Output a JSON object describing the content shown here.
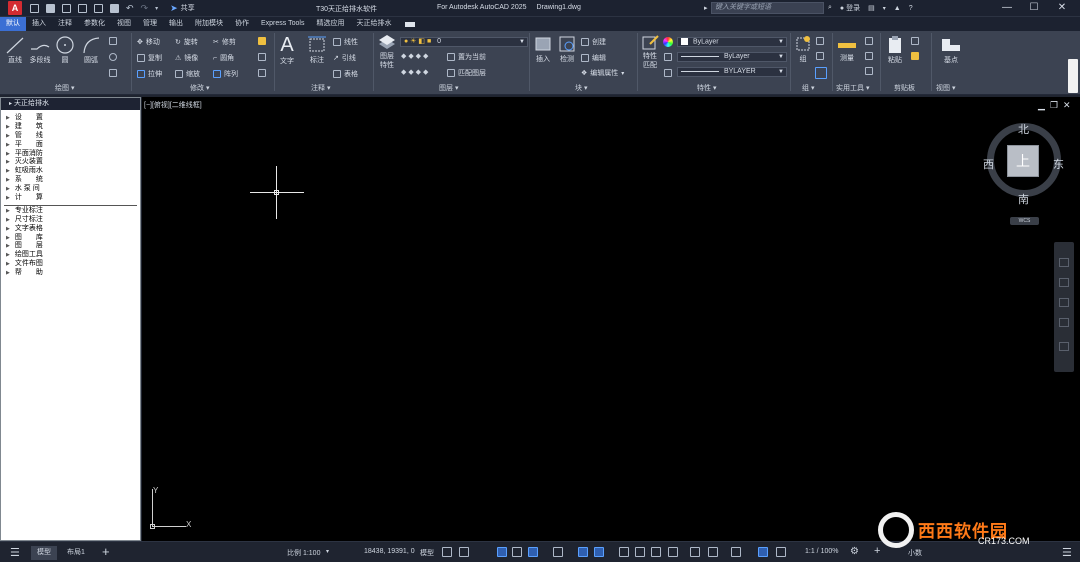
{
  "titlebar": {
    "app_title": "T30天正给排水软件",
    "product": "For Autodesk AutoCAD 2025",
    "document": "Drawing1.dwg",
    "share_label": "共享",
    "search_placeholder": "键入关键字或短语",
    "login_label": "登录",
    "app_logo": "A"
  },
  "tabs": [
    "默认",
    "插入",
    "注释",
    "参数化",
    "视图",
    "管理",
    "输出",
    "附加模块",
    "协作",
    "Express Tools",
    "精选应用",
    "天正给排水"
  ],
  "ribbon": {
    "draw": {
      "line": "直线",
      "polyline": "多段线",
      "circle": "圆",
      "arc": "圆弧",
      "title": "绘图 ▾"
    },
    "modify": {
      "move": "移动",
      "rotate": "旋转",
      "trim": "修剪",
      "copy": "复制",
      "mirror": "镜像",
      "fillet": "圆角",
      "stretch": "拉伸",
      "scale": "缩放",
      "array": "阵列",
      "title": "修改 ▾"
    },
    "annotation": {
      "text": "文字",
      "dimension": "标注",
      "linear": "线性",
      "leader": "引线",
      "table": "表格",
      "title": "注释 ▾"
    },
    "layers": {
      "layer_props": "图层\n特性",
      "current_layer": "0",
      "set_current": "置为当前",
      "match_layer": "匹配图层",
      "title": "图层 ▾"
    },
    "block": {
      "insert": "插入",
      "edit": "检测",
      "create": "创建",
      "edit_block": "编辑",
      "edit_attr": "编辑属性",
      "title": "块 ▾"
    },
    "properties": {
      "match": "特性\n匹配",
      "color": "ByLayer",
      "linetype": "ByLayer",
      "lineweight": "BYLAYER",
      "title": "特性 ▾"
    },
    "groups": {
      "group": "组",
      "title": "组 ▾"
    },
    "utilities": {
      "measure": "测量",
      "title": "实用工具 ▾"
    },
    "clipboard": {
      "paste": "粘贴",
      "title": "剪贴板"
    },
    "view": {
      "base": "基点",
      "title": "视图 ▾"
    }
  },
  "palette": {
    "title": "天正给排水",
    "group1": [
      "设　　置",
      "建　　筑",
      "管　　线",
      "平　　面",
      "平面消防",
      "灭火装置",
      "虹吸雨水",
      "系　　统",
      "水 泵 间",
      "计　　算"
    ],
    "group2": [
      "专业标注",
      "尺寸标注",
      "文字表格",
      "图　　库",
      "图　　层",
      "绘图工具",
      "文件布图",
      "帮　　助"
    ]
  },
  "canvas": {
    "view_label": "[−][俯视][二维线框]",
    "ucs_x": "X",
    "ucs_y": "Y",
    "viewcube": {
      "north": "北",
      "south": "南",
      "east": "东",
      "west": "西",
      "top": "上",
      "wcs": "WCS"
    }
  },
  "statusbar": {
    "model_tab": "模型",
    "layout_tab": "布局1",
    "add": "+",
    "scale": "比例 1:100",
    "coords": "18438, 19391, 0",
    "mode": "模型",
    "zoom": "1:1 / 100%",
    "units": "小数"
  },
  "watermark": {
    "brand": "西西软件园",
    "site": "CR173.COM"
  }
}
